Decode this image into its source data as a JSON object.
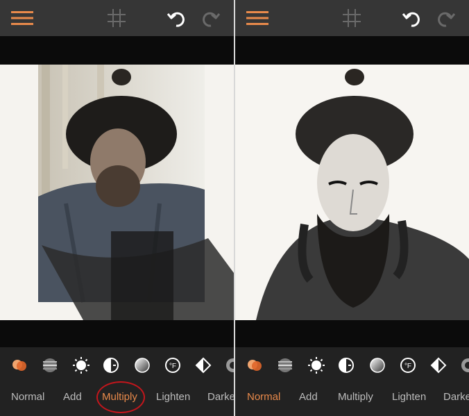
{
  "colors": {
    "accent": "#e98a4b",
    "topbar": "#363636",
    "toolbar": "#222222",
    "highlight_ring": "#c4161c"
  },
  "topbar_icons": [
    "menu-icon",
    "grid-icon",
    "undo-icon",
    "redo-icon"
  ],
  "blend_icons": [
    "overlap-circles-icon",
    "striped-sphere-icon",
    "sun-icon",
    "half-circle-plus-icon",
    "gradient-circle-icon",
    "temperature-f-icon",
    "diamond-split-icon",
    "ring-icon"
  ],
  "left_panel": {
    "modes": [
      {
        "label": "Normal"
      },
      {
        "label": "Add"
      },
      {
        "label": "Multiply"
      },
      {
        "label": "Lighten"
      },
      {
        "label": "Darke"
      }
    ],
    "selected_mode": "Multiply",
    "highlighted_mode": "Multiply"
  },
  "right_panel": {
    "modes": [
      {
        "label": "Normal"
      },
      {
        "label": "Add"
      },
      {
        "label": "Multiply"
      },
      {
        "label": "Lighten"
      },
      {
        "label": "Darke"
      }
    ],
    "selected_mode": "Normal"
  }
}
